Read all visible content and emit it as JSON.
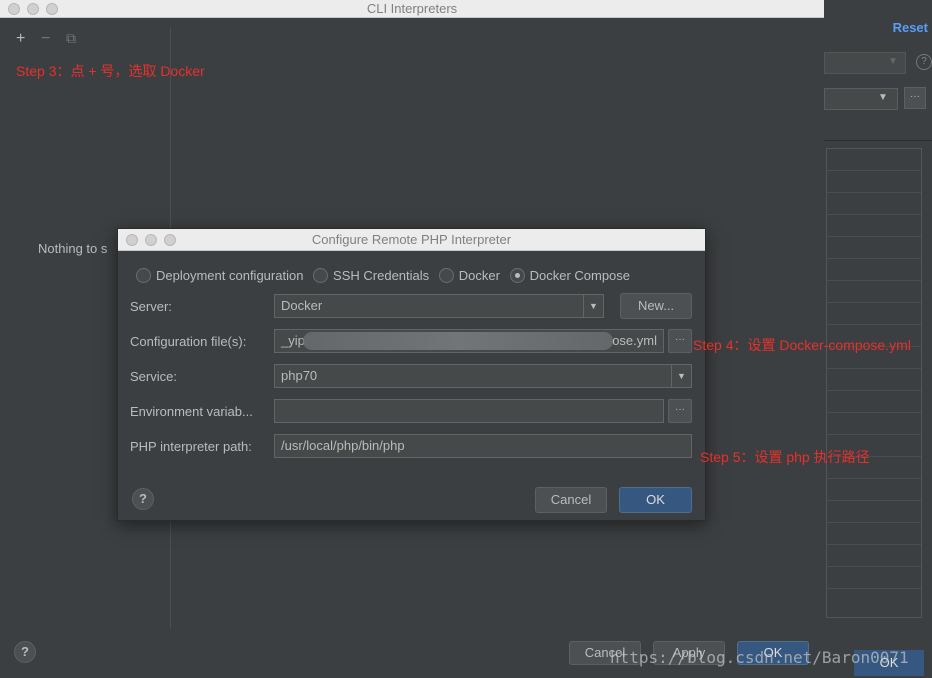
{
  "background_window": {
    "reset_label": "Reset",
    "help_glyph": "?",
    "dots_glyph": "···",
    "ok_label": "OK"
  },
  "cli_window": {
    "title": "CLI Interpreters",
    "toolbar": {
      "add_glyph": "+",
      "remove_glyph": "−",
      "copy_glyph": "⧉"
    },
    "annotation_step3": "Step 3：点 + 号，选取 Docker",
    "empty_text": "Nothing to s",
    "help_glyph": "?",
    "cancel_label": "Cancel",
    "apply_label": "Apply",
    "ok_label": "OK"
  },
  "dialog": {
    "title": "Configure Remote PHP Interpreter",
    "radios": [
      {
        "label": "Deployment configuration",
        "checked": false
      },
      {
        "label": "SSH Credentials",
        "checked": false
      },
      {
        "label": "Docker",
        "checked": false
      },
      {
        "label": "Docker Compose",
        "checked": true
      }
    ],
    "server": {
      "label": "Server:",
      "value": "Docker",
      "new_label": "New..."
    },
    "config_files": {
      "label": "Configuration file(s):",
      "value_start": "_yip",
      "value_end": "ose.yml"
    },
    "service": {
      "label": "Service:",
      "value": "php70"
    },
    "env_vars": {
      "label": "Environment variab...",
      "value": ""
    },
    "php_path": {
      "label": "PHP interpreter path:",
      "value": "/usr/local/php/bin/php"
    },
    "help_glyph": "?",
    "dots_glyph": "···",
    "arrow_glyph": "▼",
    "cancel_label": "Cancel",
    "ok_label": "OK"
  },
  "annotations": {
    "step4": "Step 4：设置 Docker-compose.yml",
    "step5": "Step 5：设置 php 执行路径"
  },
  "watermark": "https://blog.csdn.net/Baron0071",
  "colors": {
    "accent": "#365880",
    "annotation": "#e8302a",
    "link": "#589df6"
  }
}
